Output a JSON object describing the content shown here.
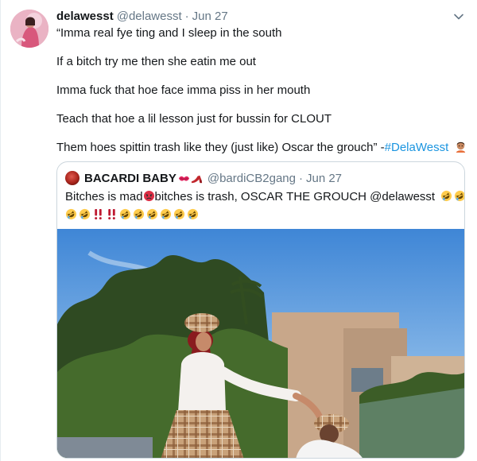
{
  "tweet": {
    "author_name": "delawesst",
    "handle": "@delawesst",
    "separator": "·",
    "date": "Jun 27",
    "lines": [
      "“Imma real fye ting and I sleep in the south",
      "If a bitch try me then she eatin me out",
      "Imma fuck that hoe face imma piss in her mouth",
      "Teach that hoe a lil lesson just for bussin for CLOUT"
    ],
    "last_line_text": "Them hoes spittin trash like they (just like) Oscar the grouch” -",
    "hashtag": "#DelaWesst",
    "trailing_emoji": "person-gesturing-emoji"
  },
  "quoted": {
    "author_name": "BACARDI BABY",
    "name_emojis": [
      "kiss-mark-emoji",
      "high-heel-emoji"
    ],
    "handle": "@bardiCB2gang",
    "separator": "·",
    "date": "Jun 27",
    "line1_a": "Bitches is mad",
    "line1_emoji": "pouting-face-emoji",
    "line1_b": "bitches is trash, OSCAR THE GROUCH @delawesst",
    "line1_trailing_emojis": [
      "rofl-emoji",
      "rofl-emoji",
      "rofl-emoji"
    ],
    "line2_emojis": [
      "rofl-emoji",
      "rofl-emoji",
      "double-exclamation-emoji",
      "double-exclamation-emoji",
      "rofl-emoji",
      "rofl-emoji",
      "rofl-emoji",
      "rofl-emoji",
      "rofl-emoji",
      "rofl-emoji"
    ],
    "media_description": "photo"
  },
  "colors": {
    "text": "#14171a",
    "secondary": "#657786",
    "link": "#1b95e0",
    "border": "#ccd6dd"
  },
  "icons": {
    "caret": "chevron-down-icon"
  }
}
